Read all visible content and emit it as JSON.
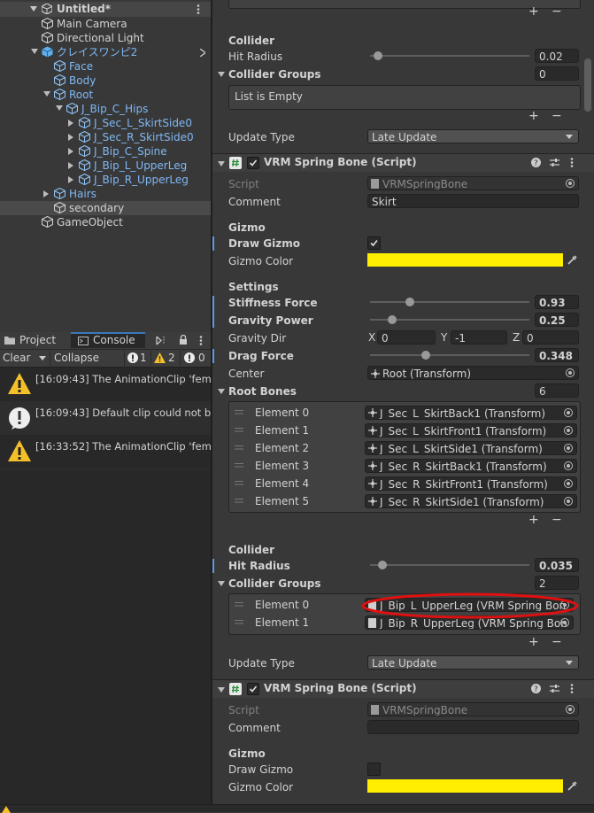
{
  "hierarchy": {
    "scene": "Untitled*",
    "items": [
      {
        "label": "Main Camera",
        "depth": 1,
        "blue": false,
        "arrow": ""
      },
      {
        "label": "Directional Light",
        "depth": 1,
        "blue": false,
        "arrow": ""
      },
      {
        "label": "クレイスワンピ2",
        "depth": 1,
        "blue": true,
        "arrow": "down"
      },
      {
        "label": "Face",
        "depth": 2,
        "blue": true,
        "arrow": ""
      },
      {
        "label": "Body",
        "depth": 2,
        "blue": true,
        "arrow": ""
      },
      {
        "label": "Root",
        "depth": 2,
        "blue": true,
        "arrow": "down"
      },
      {
        "label": "J_Bip_C_Hips",
        "depth": 3,
        "blue": true,
        "arrow": "down"
      },
      {
        "label": "J_Sec_L_SkirtSide0",
        "depth": 4,
        "blue": true,
        "arrow": "right"
      },
      {
        "label": "J_Sec_R_SkirtSide0",
        "depth": 4,
        "blue": true,
        "arrow": "right"
      },
      {
        "label": "J_Bip_C_Spine",
        "depth": 4,
        "blue": true,
        "arrow": "right"
      },
      {
        "label": "J_Bip_L_UpperLeg",
        "depth": 4,
        "blue": true,
        "arrow": "right"
      },
      {
        "label": "J_Bip_R_UpperLeg",
        "depth": 4,
        "blue": true,
        "arrow": "right"
      },
      {
        "label": "Hairs",
        "depth": 2,
        "blue": true,
        "arrow": "right"
      },
      {
        "label": "secondary",
        "depth": 2,
        "blue": false,
        "arrow": "",
        "selected": true
      },
      {
        "label": "GameObject",
        "depth": 1,
        "blue": false,
        "arrow": ""
      }
    ]
  },
  "console": {
    "tab_project": "Project",
    "tab_console": "Console",
    "clear": "Clear",
    "collapse": "Collapse",
    "count_info": "1",
    "count_warn": "2",
    "count_error": "0",
    "messages": [
      {
        "type": "warning",
        "text": "[16:09:43] The AnimationClip 'fema"
      },
      {
        "type": "info",
        "text": "[16:09:43] Default clip could not be"
      },
      {
        "type": "warning",
        "text": "[16:33:52] The AnimationClip 'fema"
      }
    ]
  },
  "inspector": {
    "collider1": {
      "title": "Collider",
      "hit_radius_label": "Hit Radius",
      "hit_radius": "0.02",
      "hit_radius_frac": 0.05,
      "groups_label": "Collider Groups",
      "groups_count": "0",
      "empty": "List is Empty"
    },
    "update_type_label": "Update Type",
    "update_type_value": "Late Update",
    "comp1": {
      "title": "VRM Spring Bone (Script)",
      "script_label": "Script",
      "script_value": "VRMSpringBone",
      "comment_label": "Comment",
      "comment_value": "Skirt",
      "gizmo_title": "Gizmo",
      "draw_gizmo_label": "Draw Gizmo",
      "draw_gizmo": true,
      "gizmo_color_label": "Gizmo Color",
      "gizmo_color": "#ffee00",
      "settings_title": "Settings",
      "stiffness_label": "Stiffness Force",
      "stiffness": "0.93",
      "stiffness_frac": 0.25,
      "gravity_power_label": "Gravity Power",
      "gravity_power": "0.25",
      "gravity_power_frac": 0.14,
      "gravity_dir_label": "Gravity Dir",
      "gx_label": "X",
      "gx": "0",
      "gy_label": "Y",
      "gy": "-1",
      "gz_label": "Z",
      "gz": "0",
      "drag_label": "Drag Force",
      "drag": "0.348",
      "drag_frac": 0.348,
      "center_label": "Center",
      "center": "Root (Transform)",
      "root_bones_label": "Root Bones",
      "root_bones_count": "6",
      "root_bones": [
        {
          "label": "Element 0",
          "value": "J_Sec_L_SkirtBack1 (Transform)"
        },
        {
          "label": "Element 1",
          "value": "J_Sec_L_SkirtFront1 (Transform)"
        },
        {
          "label": "Element 2",
          "value": "J_Sec_L_SkirtSide1 (Transform)"
        },
        {
          "label": "Element 3",
          "value": "J_Sec_R_SkirtBack1 (Transform)"
        },
        {
          "label": "Element 4",
          "value": "J_Sec_R_SkirtFront1 (Transform)"
        },
        {
          "label": "Element 5",
          "value": "J_Sec_R_SkirtSide1 (Transform)"
        }
      ],
      "collider_title": "Collider",
      "hit_radius_label": "Hit Radius",
      "hit_radius": "0.035",
      "hit_radius_frac": 0.08,
      "groups_label": "Collider Groups",
      "groups_count": "2",
      "groups": [
        {
          "label": "Element 0",
          "value": "J_Bip_L_UpperLeg (VRM Spring Bon"
        },
        {
          "label": "Element 1",
          "value": "J_Bip_R_UpperLeg (VRM Spring Bon"
        }
      ]
    },
    "comp2": {
      "title": "VRM Spring Bone (Script)",
      "script_label": "Script",
      "script_value": "VRMSpringBone",
      "comment_label": "Comment",
      "comment_value": "",
      "gizmo_title": "Gizmo",
      "draw_gizmo_label": "Draw Gizmo",
      "draw_gizmo": false,
      "gizmo_color_label": "Gizmo Color",
      "gizmo_color": "#ffee00"
    },
    "plus": "+",
    "minus": "−"
  },
  "highlight_color": "#e01010"
}
